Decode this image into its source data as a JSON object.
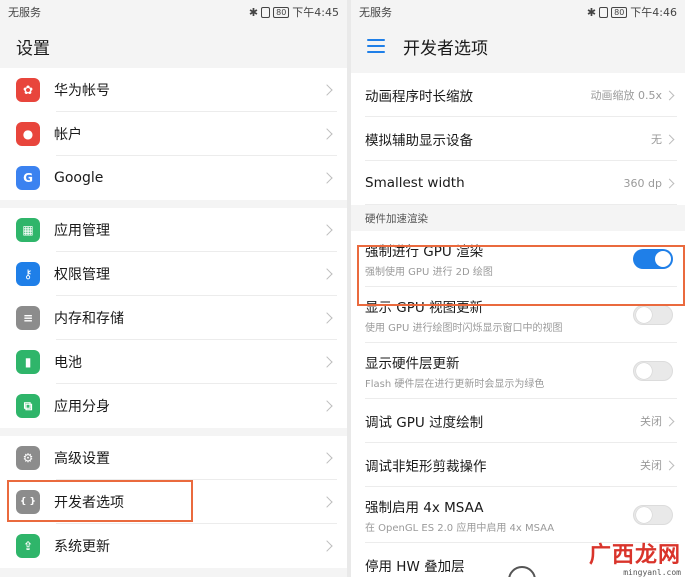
{
  "left": {
    "status": {
      "carrier": "无服务",
      "time": "下午4:45",
      "battery": "80"
    },
    "title": "设置",
    "groups": [
      [
        {
          "label": "华为帐号",
          "icon": "huawei-icon",
          "color": "#e8453c"
        },
        {
          "label": "帐户",
          "icon": "account-icon",
          "color": "#e8453c"
        },
        {
          "label": "Google",
          "icon": "google-icon",
          "color": "#3b82f0"
        }
      ],
      [
        {
          "label": "应用管理",
          "icon": "apps-icon",
          "color": "#2fb56a"
        },
        {
          "label": "权限管理",
          "icon": "key-icon",
          "color": "#1f7fe8"
        },
        {
          "label": "内存和存储",
          "icon": "storage-icon",
          "color": "#8c8c8c"
        },
        {
          "label": "电池",
          "icon": "battery-icon",
          "color": "#2fb56a"
        },
        {
          "label": "应用分身",
          "icon": "app-twin-icon",
          "color": "#2fb56a"
        }
      ],
      [
        {
          "label": "高级设置",
          "icon": "gear-icon",
          "color": "#8c8c8c"
        },
        {
          "label": "开发者选项",
          "icon": "developer-icon",
          "color": "#8c8c8c"
        },
        {
          "label": "系统更新",
          "icon": "update-icon",
          "color": "#2fb56a"
        }
      ]
    ]
  },
  "right": {
    "status": {
      "carrier": "无服务",
      "time": "下午4:46",
      "battery": "80"
    },
    "title": "开发者选项",
    "top_rows": [
      {
        "title": "动画程序时长缩放",
        "value": "动画缩放 0.5x"
      },
      {
        "title": "模拟辅助显示设备",
        "value": "无"
      },
      {
        "title": "Smallest width",
        "value": "360 dp"
      }
    ],
    "section": "硬件加速渲染",
    "hw_rows": [
      {
        "title": "强制进行 GPU 渲染",
        "sub": "强制使用 GPU 进行 2D 绘图",
        "toggle": true
      },
      {
        "title": "显示 GPU 视图更新",
        "sub": "使用 GPU 进行绘图时闪烁显示窗口中的视图",
        "toggle": false
      },
      {
        "title": "显示硬件层更新",
        "sub": "Flash 硬件层在进行更新时会显示为绿色",
        "toggle": false
      },
      {
        "title": "调试 GPU 过度绘制",
        "value": "关闭"
      },
      {
        "title": "调试非矩形剪裁操作",
        "value": "关闭"
      },
      {
        "title": "强制启用 4x MSAA",
        "sub": "在 OpenGL ES 2.0 应用中启用 4x MSAA",
        "toggle": false
      },
      {
        "title": "停用 HW 叠加层"
      }
    ]
  },
  "watermark": {
    "text": "广西龙网",
    "url": "mingyanl.com"
  },
  "colors": {
    "accent": "#1f7fe8",
    "highlight": "#ea6a3e"
  }
}
